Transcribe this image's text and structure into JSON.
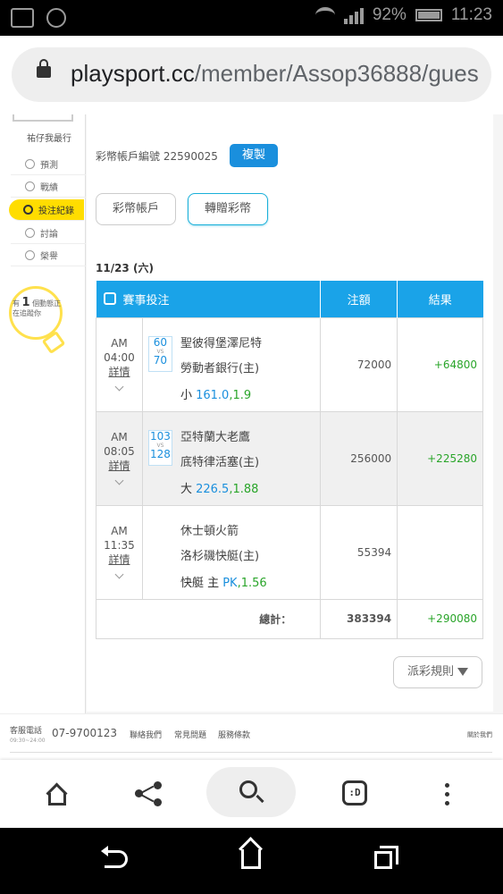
{
  "status_bar": {
    "battery": "92%",
    "time": "11:23"
  },
  "url_bar": {
    "host": "playsport.cc",
    "path": "/member/Assop36888/gues"
  },
  "sidebar": {
    "tag": "祐仔我最行",
    "items": [
      {
        "label": "預測",
        "icon": "target-icon"
      },
      {
        "label": "戰績",
        "icon": "chat-icon"
      },
      {
        "label": "投注紀錄",
        "icon": "circle-icon",
        "active": true
      },
      {
        "label": "討論",
        "icon": "discuss-icon"
      },
      {
        "label": "榮譽",
        "icon": "medal-icon"
      }
    ],
    "bulb": {
      "prefix": "有",
      "count": "1",
      "suffix": "個動態正在追蹤你"
    }
  },
  "account": {
    "label": "彩幣帳戶編號 22590025",
    "copy_label": "複製"
  },
  "tabs": {
    "account": "彩幣帳戶",
    "gift": "轉贈彩幣"
  },
  "date": "11/23 (六)",
  "table": {
    "headers": {
      "match": "賽事投注",
      "amount": "注額",
      "result": "結果"
    },
    "rows": [
      {
        "ampm": "AM",
        "time": "04:00",
        "detail": "詳情",
        "score_a": "60",
        "vs": "VS",
        "score_b": "70",
        "team_a": "聖彼得堡澤尼特",
        "team_b": "勞動者銀行(主)",
        "pick": "小",
        "line": "161.0",
        "sep": ",",
        "odds": "1.9",
        "amount": "72000",
        "result": "+64800"
      },
      {
        "ampm": "AM",
        "time": "08:05",
        "detail": "詳情",
        "score_a": "103",
        "vs": "VS",
        "score_b": "128",
        "team_a": "亞特蘭大老鷹",
        "team_b": "底特律活塞(主)",
        "pick": "大",
        "line": "226.5",
        "sep": ",",
        "odds": "1.88",
        "amount": "256000",
        "result": "+225280"
      },
      {
        "ampm": "AM",
        "time": "11:35",
        "detail": "詳情",
        "score_a": "",
        "vs": "",
        "score_b": "",
        "team_a": "休士頓火箭",
        "team_b": "洛杉磯快艇(主)",
        "pick": "快艇 主",
        "line": "PK",
        "sep": ",",
        "odds": "1.56",
        "amount": "55394",
        "result": ""
      }
    ],
    "total_label": "總計：",
    "total_amount": "383394",
    "total_result": "+290080"
  },
  "rules_button": "派彩規則",
  "footer": {
    "cs_label": "客服電話",
    "cs_hours": "09:30~24:00",
    "phone": "07-9700123",
    "links": [
      "聯絡我們",
      "常見問題",
      "服務條款"
    ],
    "right_link": "關於我們"
  },
  "colors": {
    "accent": "#1aa3e8",
    "win": "#2aa52a",
    "highlight": "#ffdd00"
  }
}
